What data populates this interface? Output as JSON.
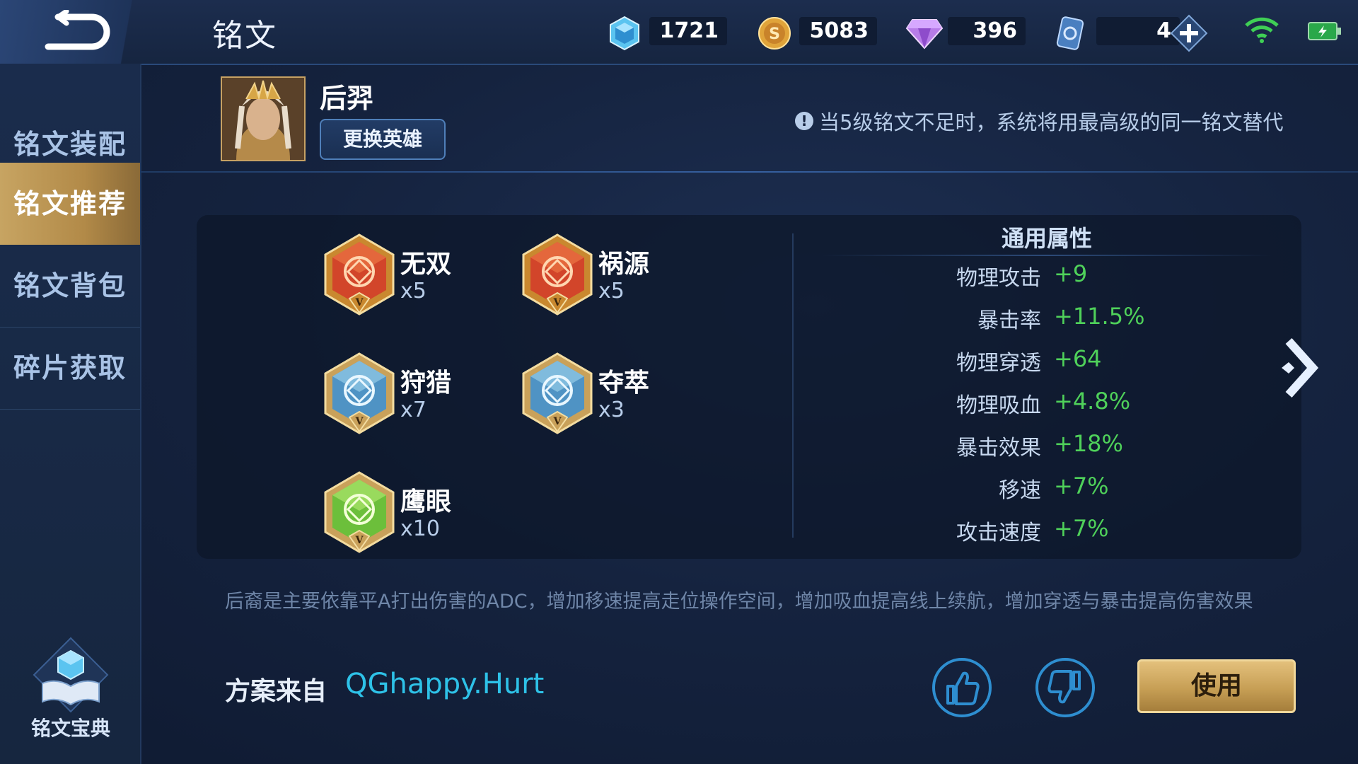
{
  "header": {
    "title": "铭文",
    "currencies": [
      {
        "name": "crystal",
        "value": "1721",
        "icon": "crystal-icon"
      },
      {
        "name": "gold",
        "value": "5083",
        "icon": "gold-coin-icon"
      },
      {
        "name": "diamond",
        "value": "396",
        "icon": "diamond-icon"
      },
      {
        "name": "voucher",
        "value": "4",
        "icon": "voucher-icon"
      }
    ],
    "colors": {
      "accent_gold": "#c7a462",
      "positive_green": "#4fd15a",
      "link_cyan": "#2ec2e8"
    }
  },
  "sidebar": {
    "items": [
      {
        "label": "铭文装配",
        "active": false
      },
      {
        "label": "铭文推荐",
        "active": true
      },
      {
        "label": "铭文背包",
        "active": false
      },
      {
        "label": "碎片获取",
        "active": false
      }
    ],
    "codex_label": "铭文宝典"
  },
  "hero": {
    "name": "后羿",
    "switch_label": "更换英雄",
    "notice": "当5级铭文不足时，系统将用最高级的同一铭文替代"
  },
  "runes": [
    {
      "name": "无双",
      "count": "x5",
      "color": "red",
      "level": "V"
    },
    {
      "name": "祸源",
      "count": "x5",
      "color": "red",
      "level": "V"
    },
    {
      "name": "狩猎",
      "count": "x7",
      "color": "blue",
      "level": "V"
    },
    {
      "name": "夺萃",
      "count": "x3",
      "color": "blue",
      "level": "V"
    },
    {
      "name": "鹰眼",
      "count": "x10",
      "color": "green",
      "level": "V"
    }
  ],
  "attributes": {
    "title": "通用属性",
    "rows": [
      {
        "name": "物理攻击",
        "value": "+9"
      },
      {
        "name": "暴击率",
        "value": "+11.5%"
      },
      {
        "name": "物理穿透",
        "value": "+64"
      },
      {
        "name": "物理吸血",
        "value": "+4.8%"
      },
      {
        "name": "暴击效果",
        "value": "+18%"
      },
      {
        "name": "移速",
        "value": "+7%"
      },
      {
        "name": "攻击速度",
        "value": "+7%"
      }
    ]
  },
  "description": "后裔是主要依靠平A打出伤害的ADC，增加移速提高走位操作空间，增加吸血提高线上续航，增加穿透与暴击提高伤害效果",
  "footer": {
    "author_label": "方案来自",
    "author_name": "QGhappy.Hurt",
    "use_label": "使用"
  }
}
